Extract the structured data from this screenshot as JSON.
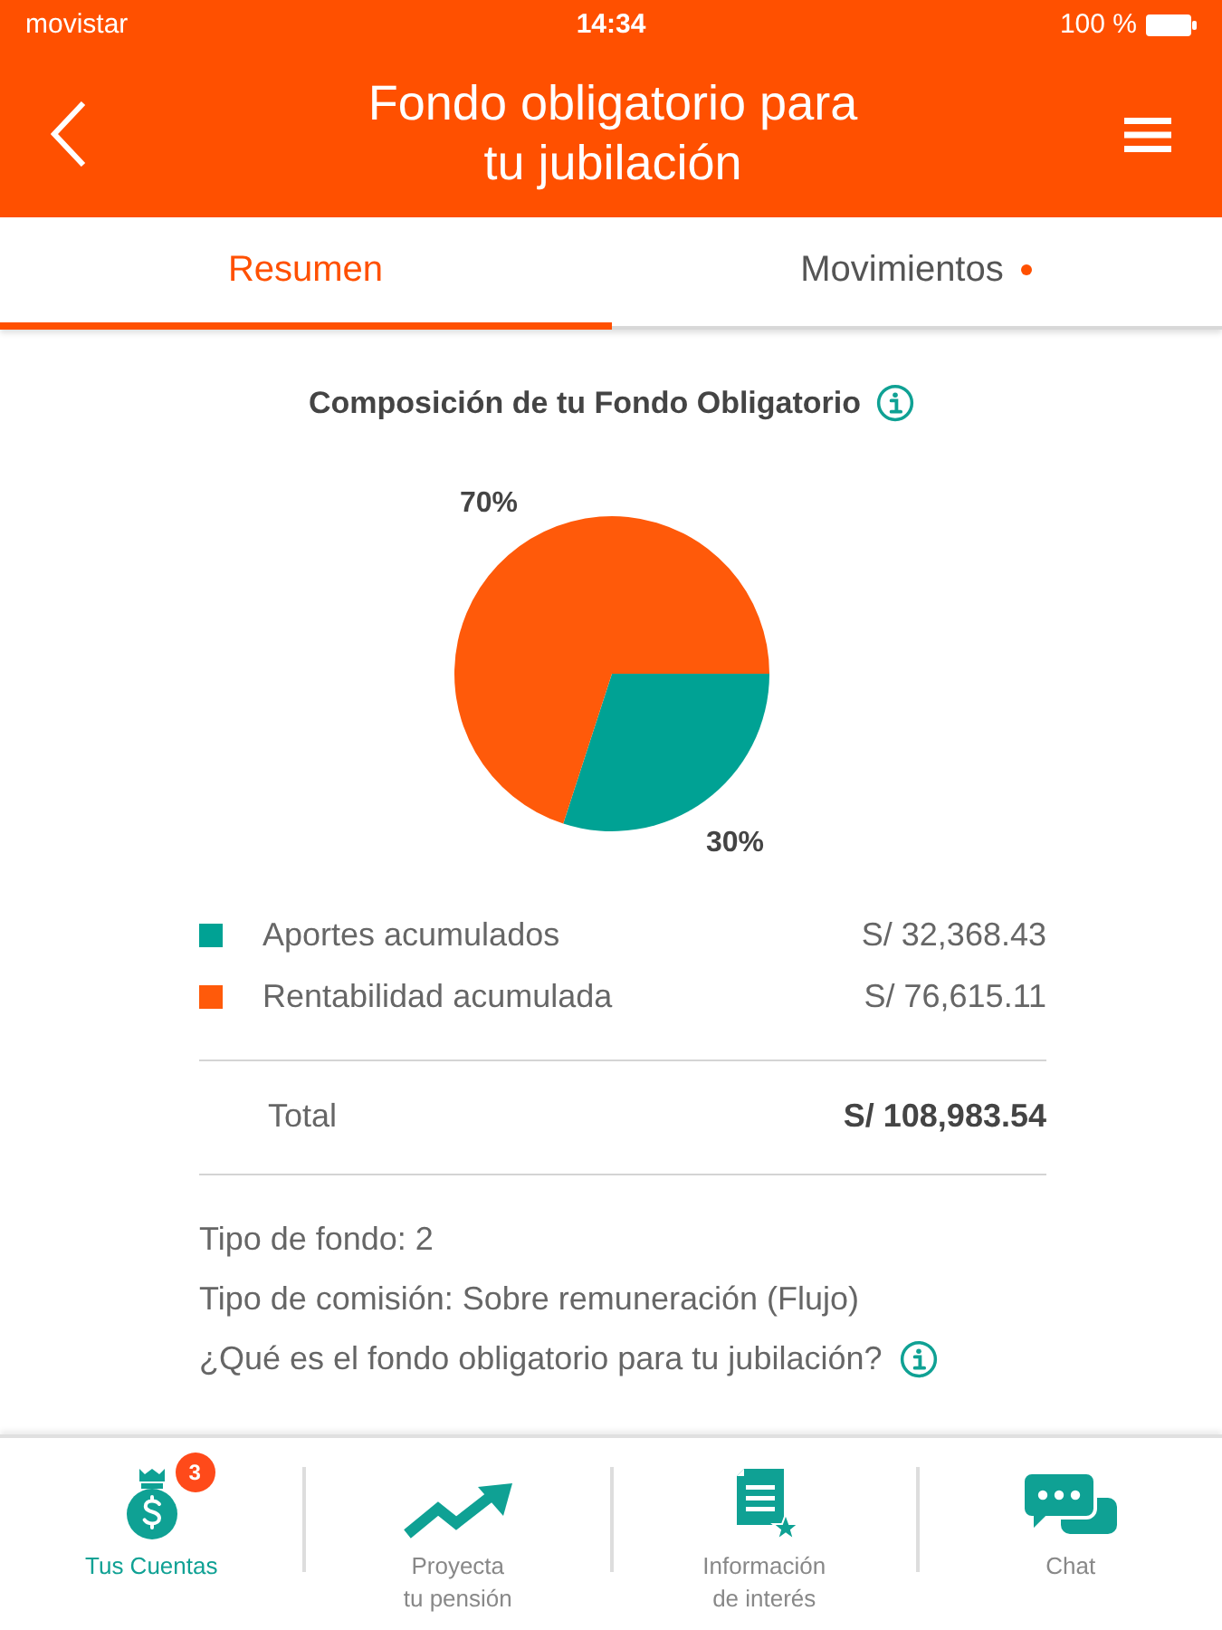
{
  "status_bar": {
    "carrier": "movistar",
    "time": "14:34",
    "battery": "100 %"
  },
  "header": {
    "title": "Fondo obligatorio para\ntu jubilación"
  },
  "tabs": [
    {
      "label": "Resumen",
      "selected": true,
      "unread": false
    },
    {
      "label": "Movimientos",
      "selected": false,
      "unread": true
    }
  ],
  "composition": {
    "title": "Composición de tu Fondo Obligatorio",
    "chart_data": {
      "type": "pie",
      "values": [
        30,
        70
      ],
      "value_labels": [
        "30%",
        "70%"
      ]
    },
    "legend": [
      {
        "label": "Aportes acumulados",
        "amount": "S/ 32,368.43",
        "color": "#00a294"
      },
      {
        "label": "Rentabilidad acumulada",
        "amount": "S/ 76,615.11",
        "color": "#ff5a0a"
      }
    ],
    "total": {
      "label": "Total",
      "amount": "S/ 108,983.54"
    }
  },
  "details": [
    "Tipo de fondo: 2",
    "Tipo de comisión: Sobre remuneración (Flujo)"
  ],
  "help_link": "¿Qué es el fondo obligatorio para tu jubilación?",
  "bottom_nav": [
    {
      "label": "Tus Cuentas",
      "selected": true,
      "badge": "3"
    },
    {
      "label": "Proyecta\ntu pensión",
      "selected": false
    },
    {
      "label": "Información\nde interés",
      "selected": false
    },
    {
      "label": "Chat",
      "selected": false
    }
  ]
}
